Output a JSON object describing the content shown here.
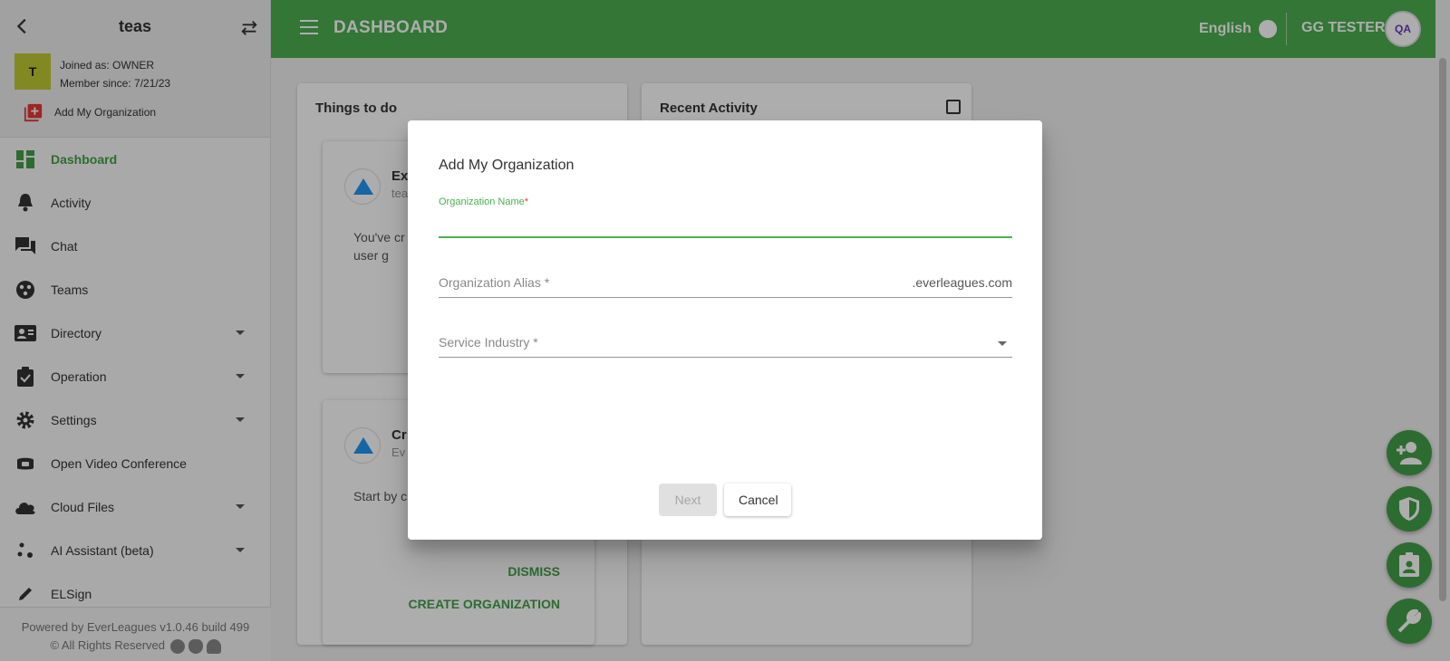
{
  "sidebar": {
    "title": "teas",
    "avatar_letter": "T",
    "joined": "Joined as: OWNER",
    "member_since": "Member since: 7/21/23",
    "add_org": "Add My Organization",
    "items": [
      {
        "label": "Dashboard",
        "icon": "dashboard-icon",
        "active": true
      },
      {
        "label": "Activity",
        "icon": "bell-icon"
      },
      {
        "label": "Chat",
        "icon": "chat-icon"
      },
      {
        "label": "Teams",
        "icon": "teams-icon"
      },
      {
        "label": "Directory",
        "icon": "contact-card-icon",
        "expandable": true
      },
      {
        "label": "Operation",
        "icon": "clipboard-check-icon",
        "expandable": true
      },
      {
        "label": "Settings",
        "icon": "gear-icon",
        "expandable": true
      },
      {
        "label": "Open Video Conference",
        "icon": "video-icon"
      },
      {
        "label": "Cloud Files",
        "icon": "cloud-icon",
        "expandable": true
      },
      {
        "label": "AI Assistant (beta)",
        "icon": "ai-icon",
        "expandable": true
      },
      {
        "label": "ELSign",
        "icon": "pen-icon"
      }
    ],
    "footer_line1": "Powered by EverLeagues v1.0.46 build 499",
    "footer_line2": "© All Rights Reserved"
  },
  "header": {
    "title": "DASHBOARD",
    "language": "English",
    "user": "GG TESTER",
    "avatar": "QA"
  },
  "content": {
    "todo_title": "Things to do",
    "recent_title": "Recent Activity",
    "task1": {
      "head": "Ex",
      "sub": "tea",
      "body": "You've cr Learn how organizat the user g"
    },
    "task2": {
      "head": "Cr",
      "sub": "Ev",
      "body": "Start by c organizat your orga",
      "dismiss": "DISMISS",
      "create": "CREATE ORGANIZATION"
    }
  },
  "dialog": {
    "title": "Add My Organization",
    "org_name_label": "Organization Name",
    "org_name_required": "*",
    "org_name_value": "",
    "alias_placeholder": "Organization Alias *",
    "alias_suffix": ".everleagues.com",
    "industry_placeholder": "Service Industry *",
    "next_label": "Next",
    "cancel_label": "Cancel"
  },
  "colors": {
    "primary": "#4caf50",
    "accent_red": "#e53935"
  }
}
